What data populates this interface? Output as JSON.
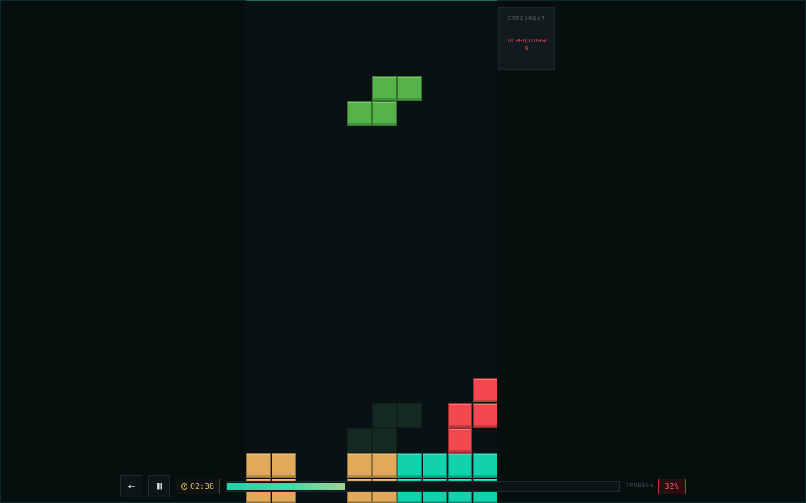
{
  "colors": {
    "s_piece": "#55b34a",
    "t_piece": "#f0484e",
    "l_piece": "#e1aa5a",
    "o_piece": "#12d2ab",
    "ghost": "#142a22",
    "board_border": "#1f6a5b",
    "board_bg": "#0a1115"
  },
  "board": {
    "columns": 10,
    "rows": 20,
    "active_piece": {
      "name": "S",
      "color": "s_piece",
      "cells": [
        [
          5,
          3
        ],
        [
          6,
          3
        ],
        [
          4,
          4
        ],
        [
          5,
          4
        ]
      ]
    },
    "ghost_piece": {
      "color": "ghost",
      "cells": [
        [
          5,
          16
        ],
        [
          6,
          16
        ],
        [
          4,
          17
        ],
        [
          5,
          17
        ]
      ]
    },
    "locked_cells": [
      {
        "col": 9,
        "row": 15,
        "color": "t_piece"
      },
      {
        "col": 8,
        "row": 16,
        "color": "t_piece"
      },
      {
        "col": 9,
        "row": 16,
        "color": "t_piece"
      },
      {
        "col": 8,
        "row": 17,
        "color": "t_piece"
      },
      {
        "col": 0,
        "row": 18,
        "color": "l_piece"
      },
      {
        "col": 1,
        "row": 18,
        "color": "l_piece"
      },
      {
        "col": 0,
        "row": 19,
        "color": "l_piece"
      },
      {
        "col": 1,
        "row": 19,
        "color": "l_piece"
      },
      {
        "col": 4,
        "row": 18,
        "color": "l_piece"
      },
      {
        "col": 5,
        "row": 18,
        "color": "l_piece"
      },
      {
        "col": 4,
        "row": 19,
        "color": "l_piece"
      },
      {
        "col": 5,
        "row": 19,
        "color": "l_piece"
      },
      {
        "col": 6,
        "row": 18,
        "color": "o_piece"
      },
      {
        "col": 7,
        "row": 18,
        "color": "o_piece"
      },
      {
        "col": 8,
        "row": 18,
        "color": "o_piece"
      },
      {
        "col": 9,
        "row": 18,
        "color": "o_piece"
      },
      {
        "col": 6,
        "row": 19,
        "color": "o_piece"
      },
      {
        "col": 7,
        "row": 19,
        "color": "o_piece"
      },
      {
        "col": 8,
        "row": 19,
        "color": "o_piece"
      },
      {
        "col": 9,
        "row": 19,
        "color": "o_piece"
      }
    ]
  },
  "next_panel": {
    "title": "СЛЕДУЮЩАЯ",
    "message": "СОСРЕДОТОЧЬСЯ"
  },
  "hud": {
    "back_icon": "arrow-left-icon",
    "back_glyph": "←",
    "pause_icon": "pause-icon",
    "pause_glyph": "❚❚",
    "timer_icon": "stopwatch-icon",
    "timer": "02:38",
    "progress_fraction": 0.3,
    "level_label": "УРОВЕНЬ",
    "level_value": "32%"
  }
}
